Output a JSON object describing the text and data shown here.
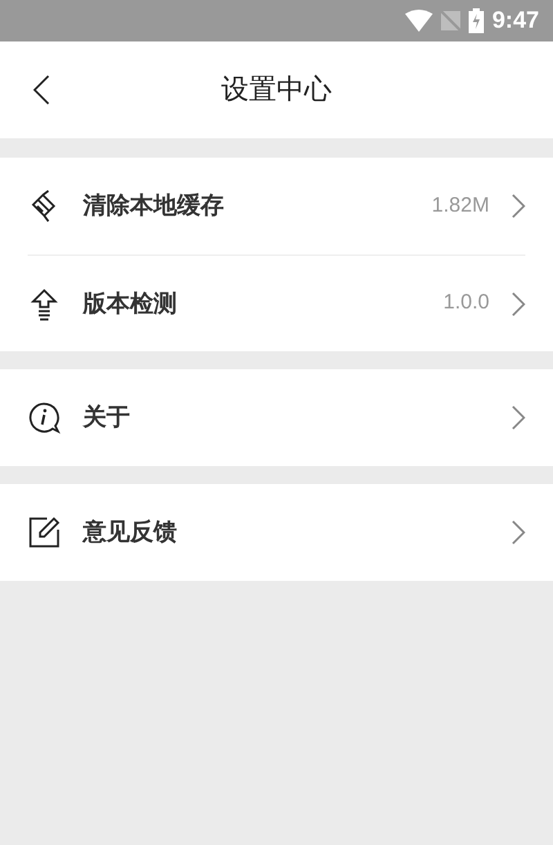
{
  "status_bar": {
    "time": "9:47"
  },
  "header": {
    "title": "设置中心"
  },
  "groups": [
    {
      "items": [
        {
          "label": "清除本地缓存",
          "value": "1.82M"
        },
        {
          "label": "版本检测",
          "value": "1.0.0"
        }
      ]
    },
    {
      "items": [
        {
          "label": "关于"
        }
      ]
    },
    {
      "items": [
        {
          "label": "意见反馈"
        }
      ]
    }
  ]
}
